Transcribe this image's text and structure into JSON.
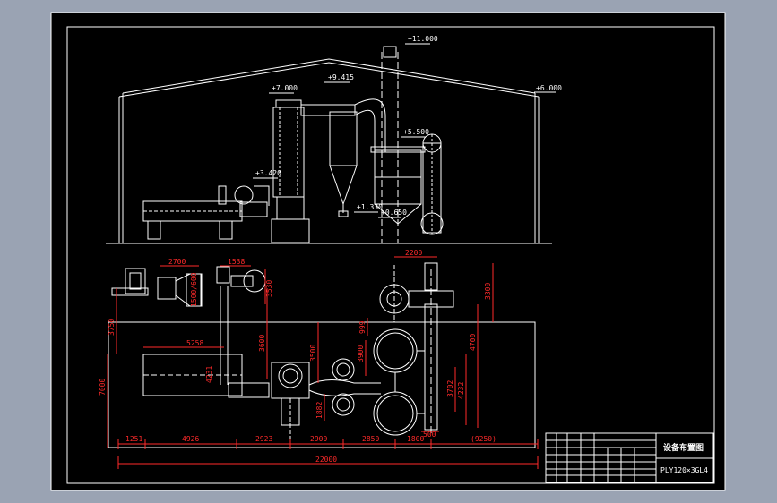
{
  "window": {
    "background_color": "#9aa3b3",
    "canvas_color": "#000000",
    "line_color": "#ffffff",
    "dimension_color": "#ff2a2a"
  },
  "elevation": {
    "labels": [
      "+11.000",
      "+9.415",
      "+7.000",
      "+6.000",
      "+5.500",
      "+3.420",
      "+1.330",
      "+0.650"
    ]
  },
  "plan": {
    "dims_top": [
      "2700",
      "1538",
      "2200"
    ],
    "dims_vertical": [
      "3750",
      "7000",
      "3600",
      "3500",
      "3900",
      "1882",
      "4232",
      "3702",
      "4700",
      "3300",
      "999",
      "3530"
    ],
    "dims_misc": [
      "1500/600",
      "5258",
      "4231"
    ],
    "dims_bottom": [
      "1251",
      "4926",
      "2923",
      "2900",
      "2850",
      "1800",
      "(9250)"
    ],
    "dims_total": "22000",
    "dims_small": [
      "500"
    ]
  },
  "title_block": {
    "title": "设备布置图",
    "drawing_no": "PLY120×3GL4"
  }
}
